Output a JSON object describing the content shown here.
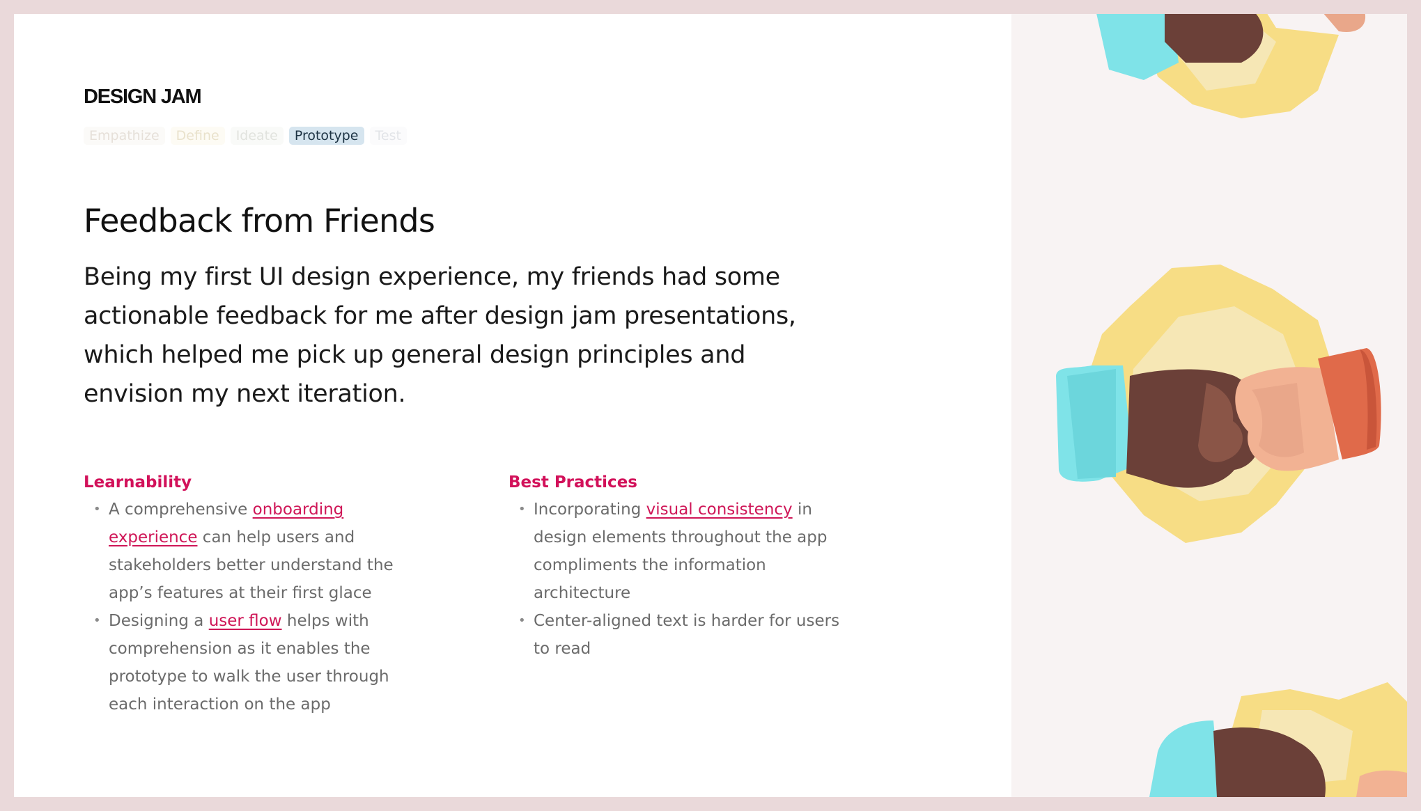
{
  "header": {
    "brand": "DESIGN JAM",
    "tabs": [
      {
        "label": "Empathize"
      },
      {
        "label": "Define"
      },
      {
        "label": "Ideate"
      },
      {
        "label": "Prototype",
        "active": true
      },
      {
        "label": "Test"
      }
    ]
  },
  "main": {
    "title": "Feedback from Friends",
    "intro": "Being my first UI design experience, my friends had some actionable feedback for me after design jam presentations, which helped me pick up general design principles and envision my next iteration."
  },
  "columns": [
    {
      "heading": "Learnability",
      "items": [
        {
          "before": "A comprehensive ",
          "link": "onboarding experience",
          "after": " can help users and stakeholders better understand the app’s features at their first glace"
        },
        {
          "before": "Designing a ",
          "link": "user flow",
          "after": " helps with comprehension as it enables the prototype to walk the user through each interaction on the app"
        }
      ]
    },
    {
      "heading": "Best Practices",
      "items": [
        {
          "before": "Incorporating ",
          "link": "visual consistency",
          "after": " in design elements throughout the app compliments the information architecture"
        },
        {
          "text": "Center-aligned text is harder for users to read"
        }
      ]
    }
  ],
  "colors": {
    "accent": "#d2115a",
    "page_bg": "#ead9da",
    "active_tab_bg": "#d6e5ef",
    "illustration_star": "#f7dd85",
    "cuff_teal": "#7fe3e8",
    "cuff_orange": "#e06a4a"
  },
  "icons": [
    "fist-bump-illustration"
  ]
}
